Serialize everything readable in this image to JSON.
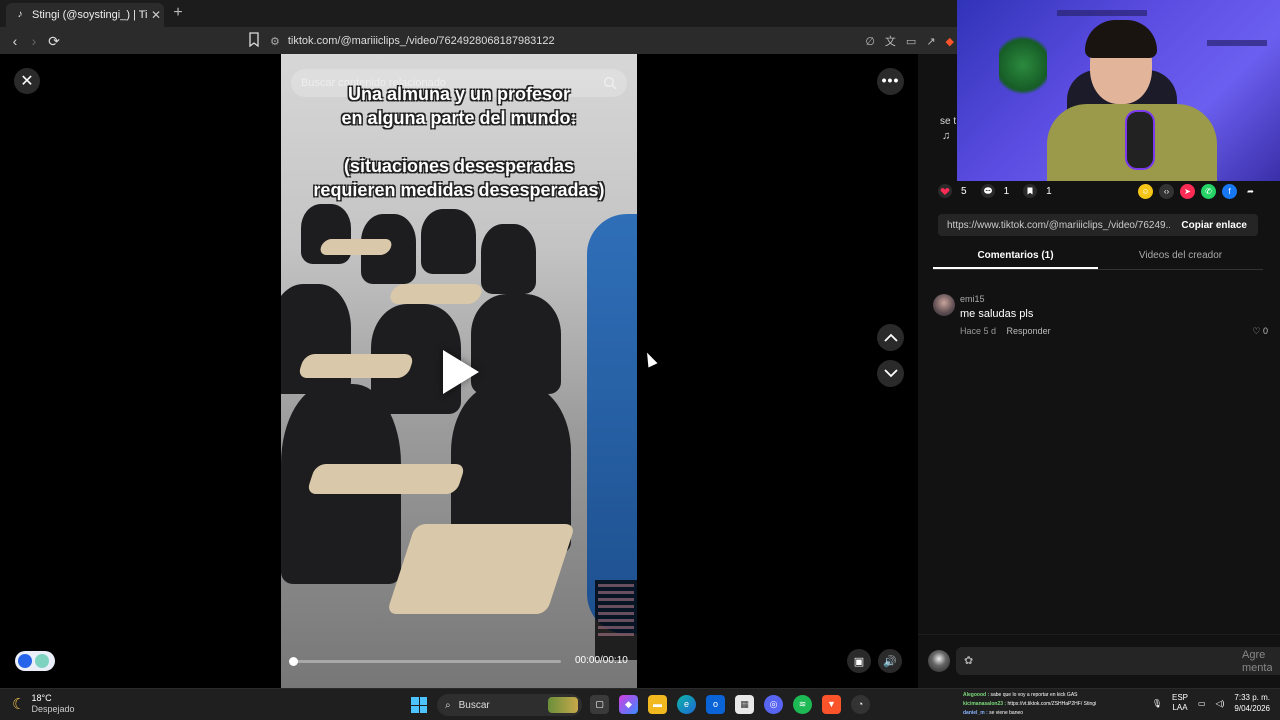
{
  "browser": {
    "tab_title": "Stingi (@soystingi_) | TikTok",
    "tab_close": "✕",
    "new_tab": "+",
    "url": "tiktok.com/@mariiiclips_/video/7624928068187983122"
  },
  "viewer": {
    "close_symbol": "✕",
    "search_placeholder": "Buscar contenido relacionado",
    "caption_line1": "Una almuna y un profesor",
    "caption_line2": "en alguna parte del mundo:",
    "caption_line3": "(situaciones desesperadas",
    "caption_line4": "requieren medidas desesperadas)",
    "time": "00:00/00:10",
    "progress": 0.0,
    "more_symbol": "•••"
  },
  "panel": {
    "partial_text": "se t",
    "stats": {
      "likes": "5",
      "comments": "1",
      "saves": "1"
    },
    "link": "https://www.tiktok.com/@mariiiclips_/video/76249...",
    "copy_label": "Copiar enlace",
    "tabs": [
      {
        "label": "Comentarios (1)",
        "active": true
      },
      {
        "label": "Videos del creador",
        "active": false
      }
    ],
    "comment": {
      "user": "emi15",
      "text": "me saludas pls",
      "time": "Hace 5 d",
      "reply": "Responder",
      "likes": "0"
    },
    "compose_hint": "Agre menta"
  },
  "taskbar": {
    "temperature": "18°C",
    "weather": "Despejado",
    "search": "Buscar",
    "chat_line1_user": "Alegoood :",
    "chat_line1": "sabe que lo voy a reportar en kick GAS",
    "chat_line2_user": "kicimanasalon23 :",
    "chat_line2": "https://vt.tiktok.com/ZSHHaP2HF/",
    "chat_line2_extra": "Stingi",
    "chat_line3_user": "daniel_m :",
    "chat_line3": "se viene baneo",
    "lang_top": "ESP",
    "lang_bottom": "LAA",
    "time": "7:33 p. m.",
    "date": "9/04/2026"
  },
  "colors": {
    "accent_like": "#fe2c55",
    "page_bg": "#000000",
    "panel_bg": "#121212"
  }
}
